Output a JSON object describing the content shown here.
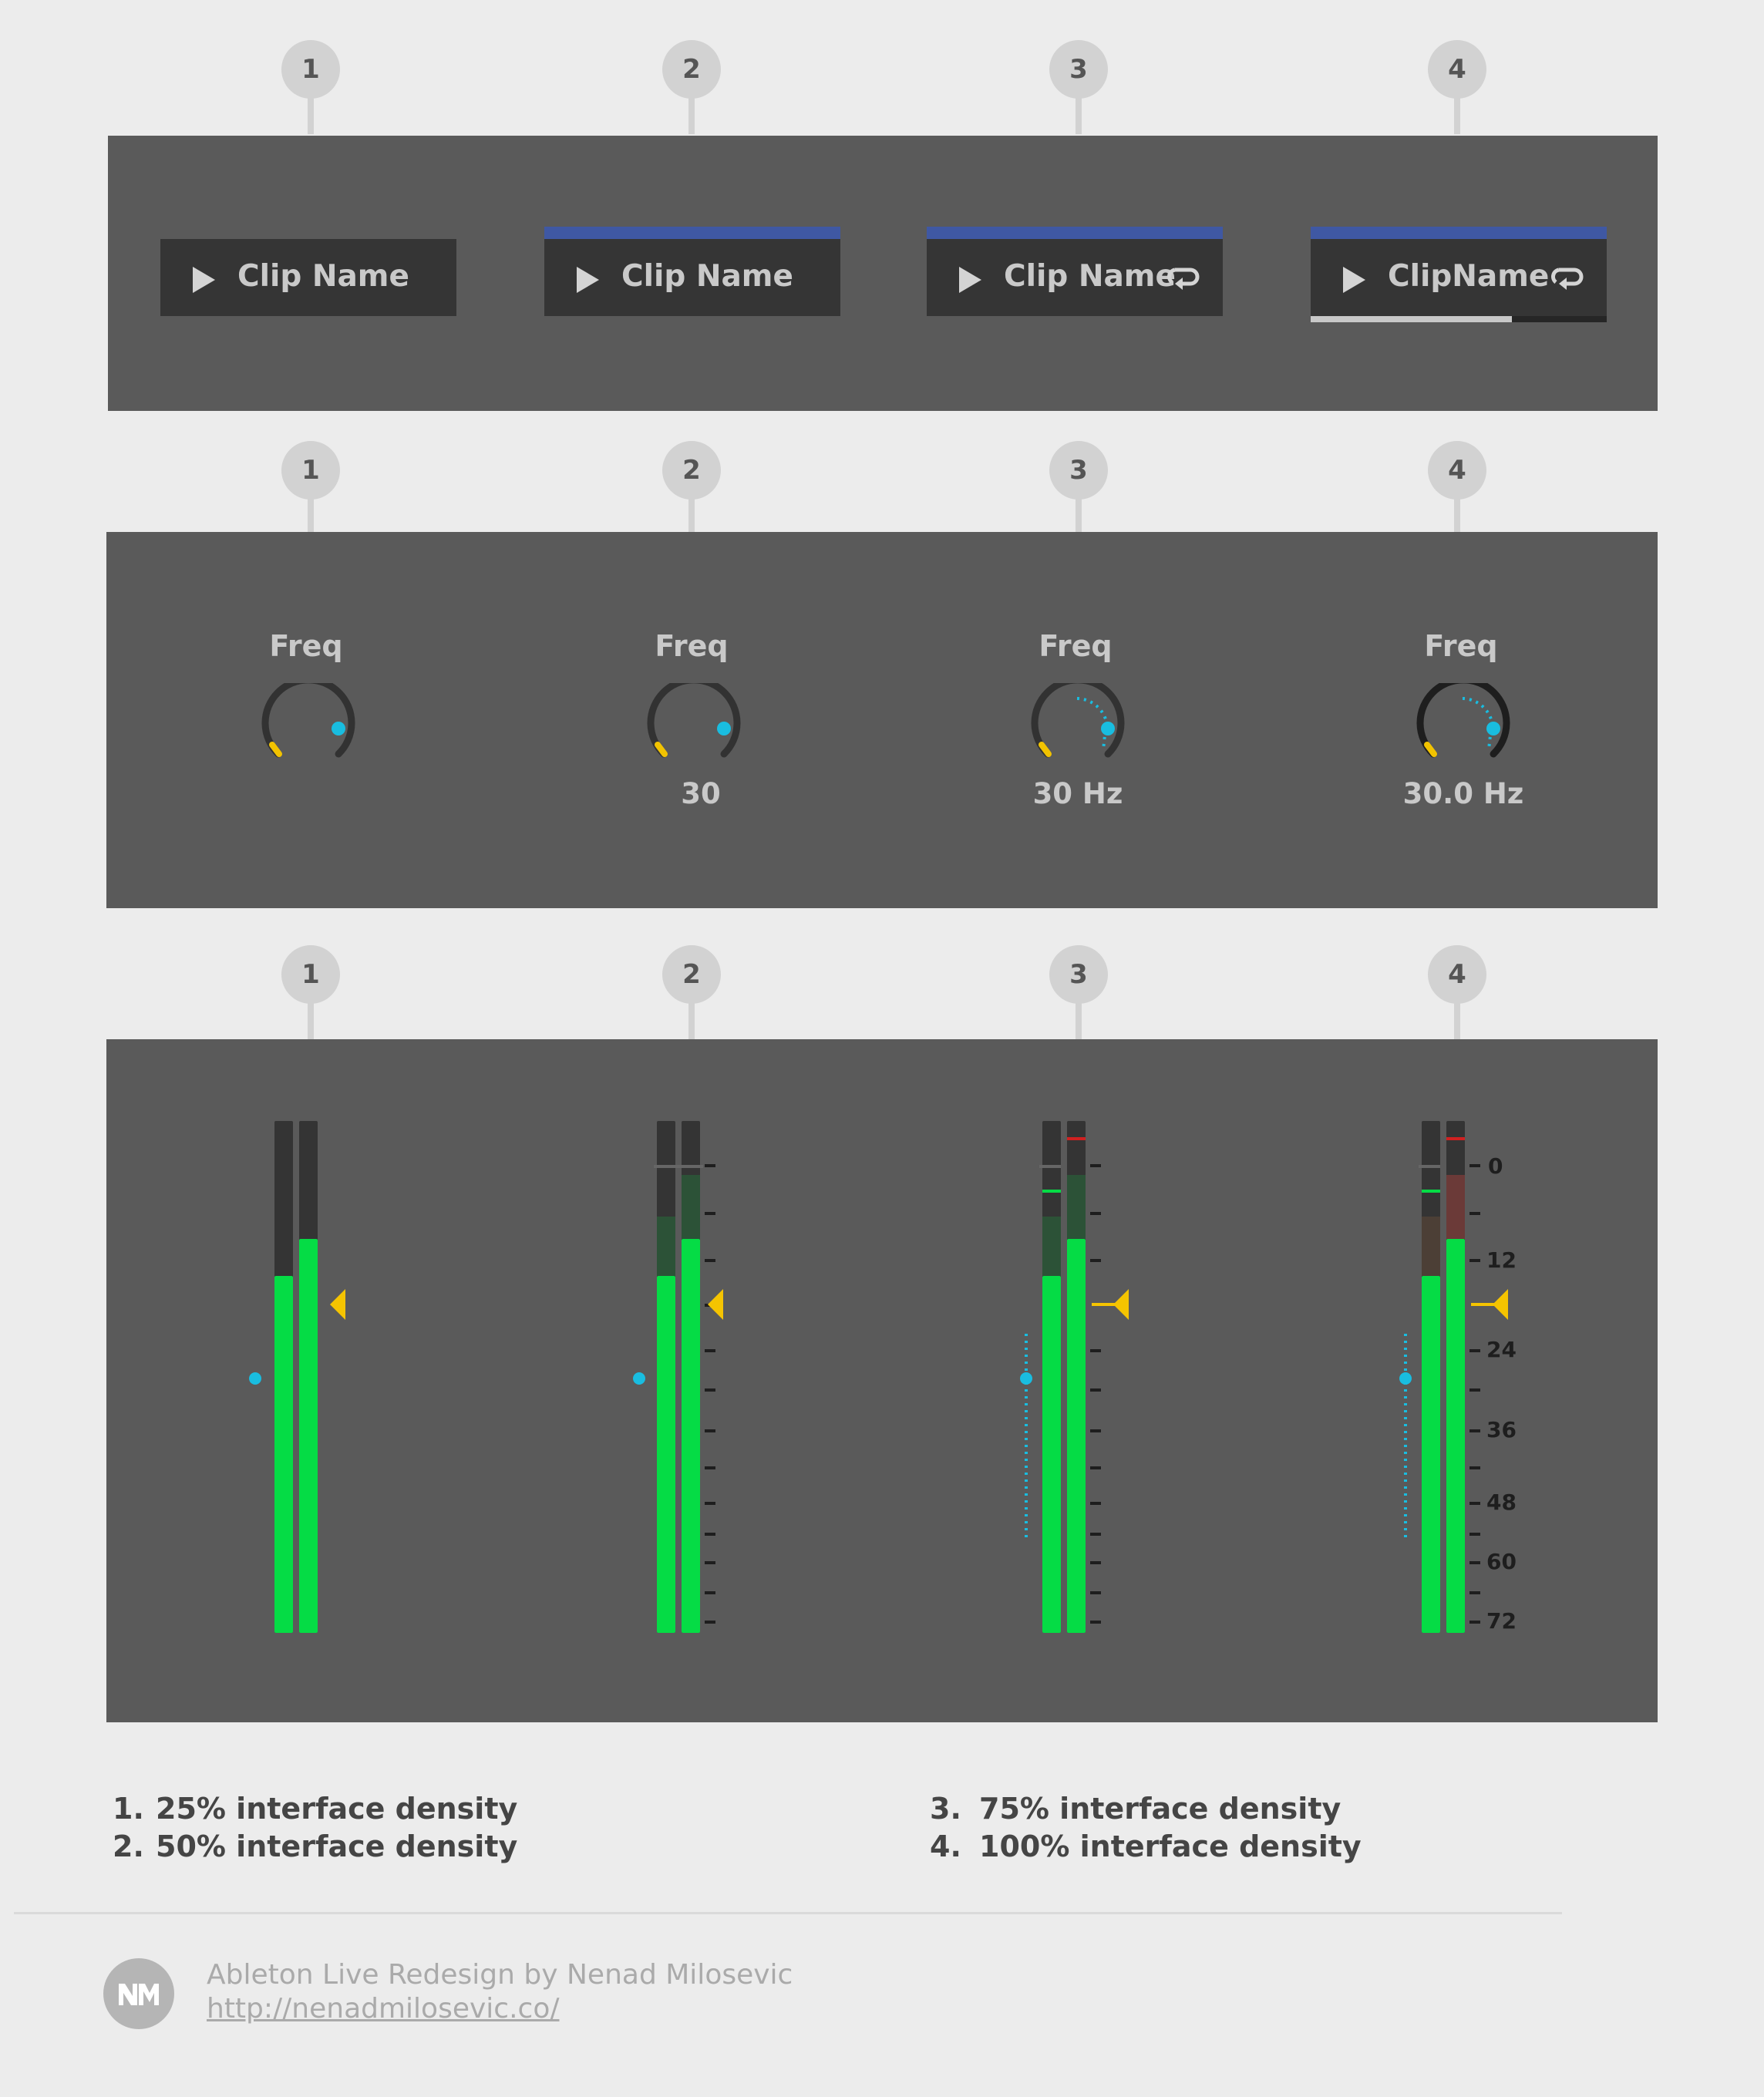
{
  "badges": [
    "1",
    "2",
    "3",
    "4"
  ],
  "clips": [
    {
      "label": "Clip Name",
      "loop": false,
      "top_bar": false,
      "progress": null
    },
    {
      "label": "Clip Name",
      "loop": false,
      "top_bar": true,
      "progress": null
    },
    {
      "label": "Clip Name",
      "loop": true,
      "top_bar": true,
      "progress": null
    },
    {
      "label": "ClipName",
      "loop": true,
      "top_bar": true,
      "progress": 0.68
    }
  ],
  "knobs": [
    {
      "title": "Freq",
      "value": ""
    },
    {
      "title": "Freq",
      "value": "30"
    },
    {
      "title": "Freq",
      "value": "30 Hz"
    },
    {
      "title": "Freq",
      "value": "30.0 Hz"
    }
  ],
  "meter_scale": [
    "0",
    "12",
    "24",
    "36",
    "48",
    "60",
    "72"
  ],
  "legend": [
    {
      "num": "1.",
      "text": "25% interface density"
    },
    {
      "num": "2.",
      "text": "50% interface density"
    },
    {
      "num": "3.",
      "text": "75% interface density"
    },
    {
      "num": "4.",
      "text": "100% interface density"
    }
  ],
  "footer": {
    "credit": "Ableton Live Redesign by Nenad Milosevic",
    "url": "http://nenadmilosevic.co/",
    "logo_text": "NM"
  },
  "colors": {
    "panel": "#5a5a5a",
    "clip_bg": "#353535",
    "clip_top_bar": "#3f58a3",
    "knob_dot": "#19bde0",
    "knob_min_mark": "#f2c300",
    "meter_green": "#05dc45",
    "meter_pointer": "#f5c400",
    "peak_red": "#d02020"
  }
}
